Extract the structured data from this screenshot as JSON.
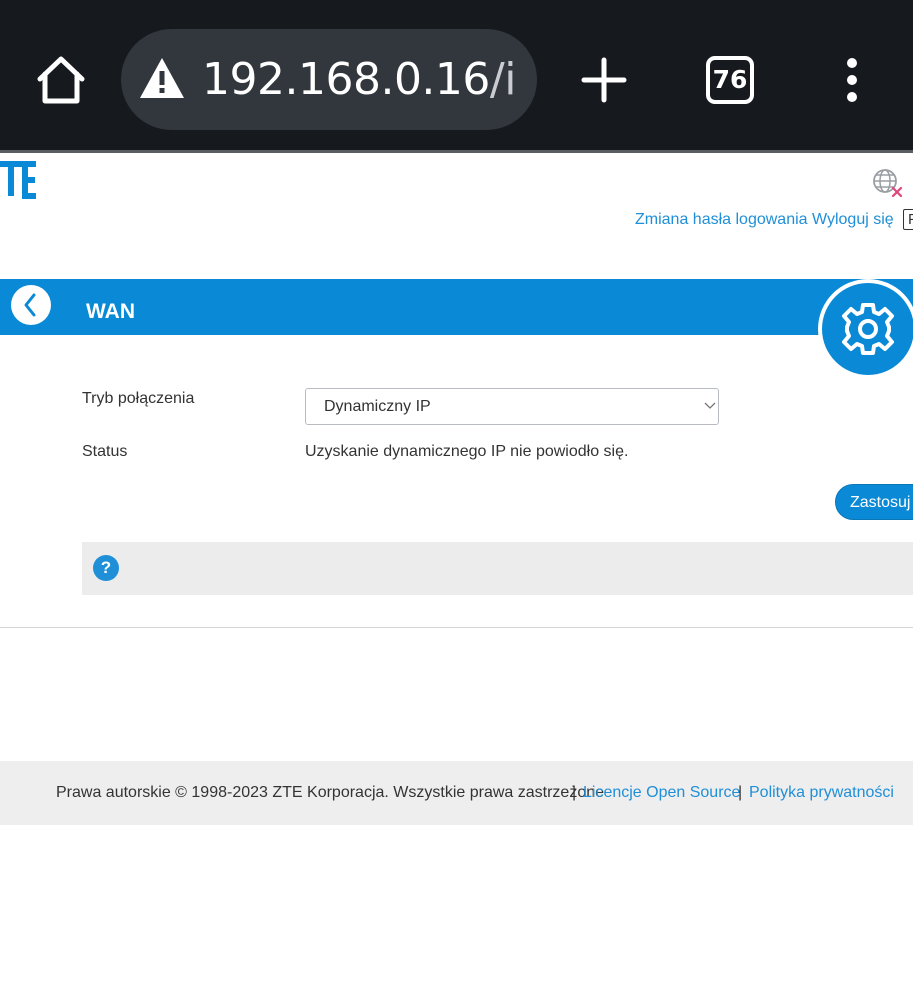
{
  "browser": {
    "url_host": "192.168.0.16",
    "url_path": "/index",
    "tab_count": "76",
    "icons": {
      "home": "home-icon",
      "warning": "warning-icon",
      "new_tab": "plus-icon",
      "menu": "more-vertical-icon"
    }
  },
  "header": {
    "logo_text": "ZTE",
    "lang_icon": "globe-icon",
    "change_password": "Zmiana hasła logowania",
    "logout": "Wyloguj się",
    "cutoff_label": "P"
  },
  "page": {
    "title": "WAN",
    "back_icon": "chevron-left-icon",
    "settings_icon": "gear-icon"
  },
  "form": {
    "connection_mode_label": "Tryb połączenia",
    "connection_mode_value": "Dynamiczny IP",
    "status_label": "Status",
    "status_value": "Uzyskanie dynamicznego IP nie powiodło się.",
    "apply_label": "Zastosuj"
  },
  "help": {
    "icon_text": "?"
  },
  "footer": {
    "copyright": "Prawa autorskie © 1998-2023 ZTE Korporacja. Wszystkie prawa zastrzeżone",
    "separator": "|",
    "licenses": "Licencje Open Source",
    "privacy": "Polityka prywatności"
  },
  "colors": {
    "accent": "#0a8ad6",
    "link": "#1f8fd7",
    "browser_bg": "#16191d",
    "url_pill": "#32373d"
  }
}
